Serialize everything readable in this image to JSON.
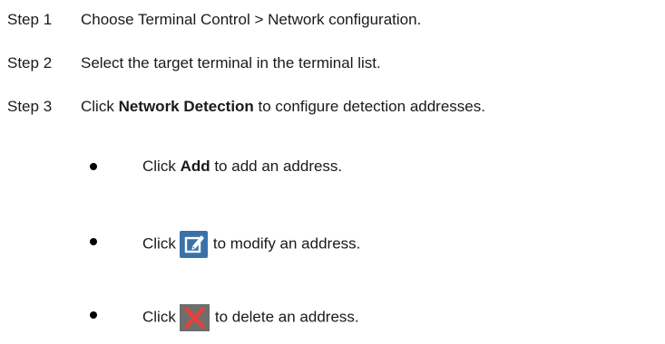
{
  "steps": [
    {
      "label": "Step 1",
      "text": "Choose Terminal Control > Network configuration."
    },
    {
      "label": "Step 2",
      "text": "Select the target terminal in the terminal list."
    },
    {
      "label": "Step 3",
      "prefix": "Click ",
      "bold": "Network Detection",
      "suffix": " to configure detection addresses."
    }
  ],
  "bullets": [
    {
      "prefix": "Click ",
      "bold": "Add",
      "suffix": " to add an address."
    },
    {
      "prefix": "Click",
      "icon": "edit-icon",
      "suffix": "to modify an address."
    },
    {
      "prefix": "Click",
      "icon": "delete-icon",
      "suffix": "to delete an address."
    }
  ],
  "colors": {
    "edit_icon_bg": "#3a72a8",
    "delete_icon_bg": "#6e6e6e",
    "delete_icon_x": "#e8403a"
  }
}
